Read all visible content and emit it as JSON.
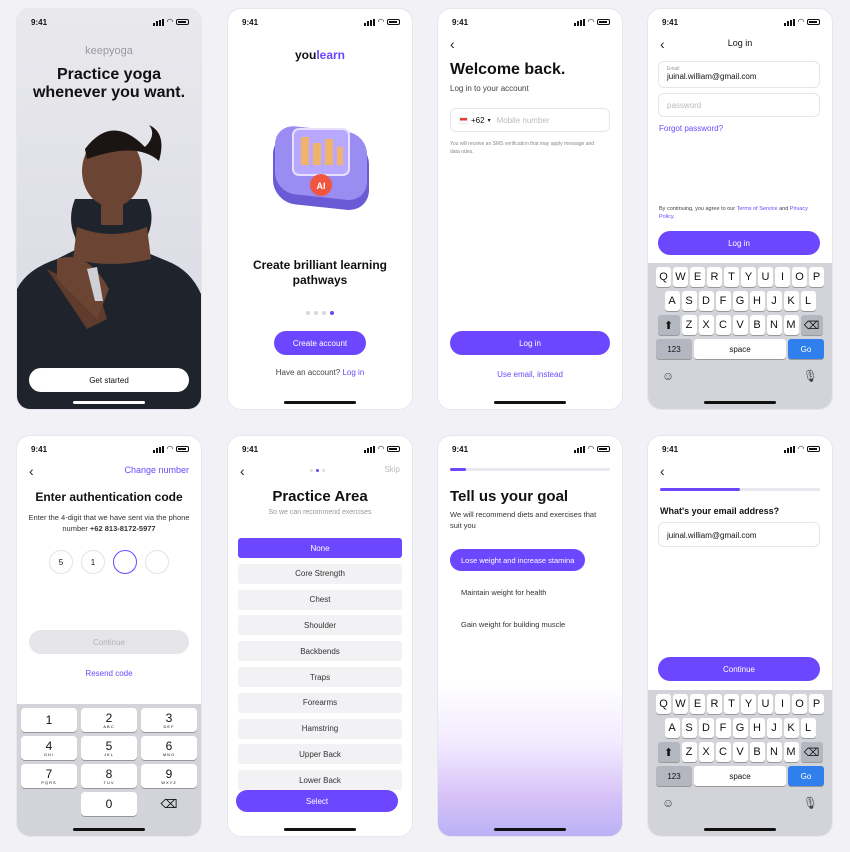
{
  "status": {
    "time": "9:41"
  },
  "s1": {
    "brand": "keepyoga",
    "headline": "Practice yoga whenever you want.",
    "cta": "Get started"
  },
  "s2": {
    "brand_a": "you",
    "brand_b": "learn",
    "illus_text": "AI",
    "title": "Create brilliant learning pathways",
    "cta": "Create account",
    "prompt": "Have an account?",
    "login_link": "Log in"
  },
  "s3": {
    "title": "Welcome back.",
    "subtitle": "Log in to your account",
    "country_code": "+62",
    "phone_placeholder": "Mobile number",
    "note": "You will receive an SMS verification that may apply message and data rates.",
    "cta": "Log in",
    "alt_link": "Use email, instead"
  },
  "s4": {
    "header": "Log in",
    "email_label": "Email",
    "email_value": "juinal.william@gmail.com",
    "password_placeholder": "password",
    "forgot": "Forgot password?",
    "terms_prefix": "By continuing, you agree to our",
    "terms_link": "Terms of Service",
    "terms_and": "and",
    "privacy_link": "Privacy Policy.",
    "cta": "Log in"
  },
  "keyboard": {
    "row1": [
      "Q",
      "W",
      "E",
      "R",
      "T",
      "Y",
      "U",
      "I",
      "O",
      "P"
    ],
    "row2": [
      "A",
      "S",
      "D",
      "F",
      "G",
      "H",
      "J",
      "K",
      "L"
    ],
    "row3": [
      "Z",
      "X",
      "C",
      "V",
      "B",
      "N",
      "M"
    ],
    "numbers": "123",
    "space": "space",
    "go": "Go"
  },
  "s5": {
    "change": "Change number",
    "title": "Enter authentication code",
    "desc": "Enter the 4-digit that we have sent via the phone number",
    "phone": "+62 813-8172-5977",
    "digits": [
      "5",
      "1",
      "",
      ""
    ],
    "cta": "Continue",
    "resend": "Resend code"
  },
  "numpad": [
    [
      {
        "n": "1",
        "l": ""
      },
      {
        "n": "2",
        "l": "ABC"
      },
      {
        "n": "3",
        "l": "DEF"
      }
    ],
    [
      {
        "n": "4",
        "l": "GHI"
      },
      {
        "n": "5",
        "l": "JKL"
      },
      {
        "n": "6",
        "l": "MNO"
      }
    ],
    [
      {
        "n": "7",
        "l": "PQRS"
      },
      {
        "n": "8",
        "l": "TUV"
      },
      {
        "n": "9",
        "l": "WXYZ"
      }
    ]
  ],
  "numpad_zero": "0",
  "s6": {
    "skip": "Skip",
    "title": "Practice Area",
    "subtitle": "So we can recommend exercises",
    "options": [
      "None",
      "Core Strength",
      "Chest",
      "Shoulder",
      "Backbends",
      "Traps",
      "Forearms",
      "Hamstring",
      "Upper Back",
      "Lower Back"
    ],
    "cta": "Select"
  },
  "s7": {
    "title": "Tell us your goal",
    "desc": "We will recommend diets and exercises that suit you",
    "goals": [
      "Lose weight and increase stamina",
      "Maintain weight for health",
      "Gain weight for building muscle"
    ]
  },
  "s8": {
    "question": "What's your email address?",
    "email_value": "juinal.william@gmail.com",
    "cta": "Continue"
  },
  "colors": {
    "accent": "#6c47ff",
    "go": "#2f80ed"
  }
}
